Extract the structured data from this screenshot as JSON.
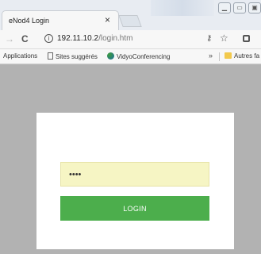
{
  "browser": {
    "tab": {
      "title": "eNod4 Login",
      "close_glyph": "×"
    },
    "address_bar": {
      "url_host": "192.11.10.2",
      "url_path": "/login.htm"
    },
    "nav": {
      "back_glyph": "→",
      "reload_glyph": "C",
      "info_glyph": "ⓘ"
    },
    "bookmarks": [
      {
        "label": "Applications",
        "icon": "apps-icon"
      },
      {
        "label": "Sites suggérés",
        "icon": "page-icon"
      },
      {
        "label": "VidyoConferencing",
        "icon": "globe-icon"
      }
    ],
    "overflow_glyph": "»",
    "other_bookmarks": {
      "label": "Autres fa",
      "icon": "folder-icon"
    },
    "icons": {
      "key": "🔑",
      "star": "☆"
    }
  },
  "login_form": {
    "password_value": "••••",
    "login_label": "LOGIN",
    "button_color": "#4cae4c",
    "input_color": "#f6f5c4"
  }
}
